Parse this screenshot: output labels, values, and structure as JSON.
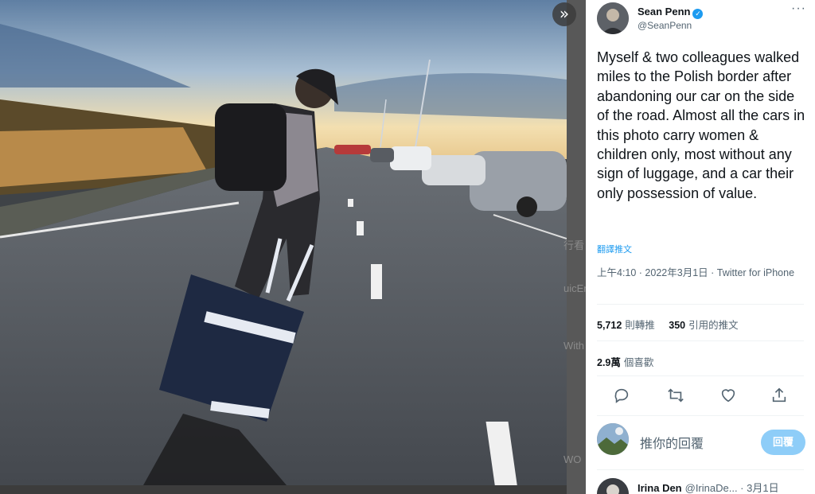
{
  "media": {
    "collapse_icon": "double-chevron-right-icon"
  },
  "scrim_texts": [
    "行看",
    "uicEn",
    "With",
    "WO"
  ],
  "tweet": {
    "author_name": "Sean Penn",
    "author_handle": "@SeanPenn",
    "verified_icon": "✓",
    "more_icon": "···",
    "text": "Myself & two colleagues walked miles to the Polish border after abandoning our car on the side of the road. Almost all the cars in this photo carry women & children only, most without any sign of luggage, and a car their only possession of value.",
    "translate_label": "翻譯推文",
    "time_line": "上午4:10 · 2022年3月1日 · Twitter for iPhone",
    "retweets_count": "5,712",
    "retweets_label": "則轉推",
    "quotes_count": "350",
    "quotes_label": "引用的推文",
    "likes_count": "2.9萬",
    "likes_label": "個喜歡"
  },
  "actions": [
    "reply-icon",
    "retweet-icon",
    "like-icon",
    "share-icon"
  ],
  "reply_box": {
    "placeholder": "推你的回覆",
    "button_label": "回覆"
  },
  "reply_preview": {
    "name": "Irina Den",
    "handle_time": "@IrinaDe... · 3月1日"
  },
  "colors": {
    "accent": "#1d9bf0",
    "reply_button": "#8ecdf8",
    "secondary_text": "#536471"
  }
}
